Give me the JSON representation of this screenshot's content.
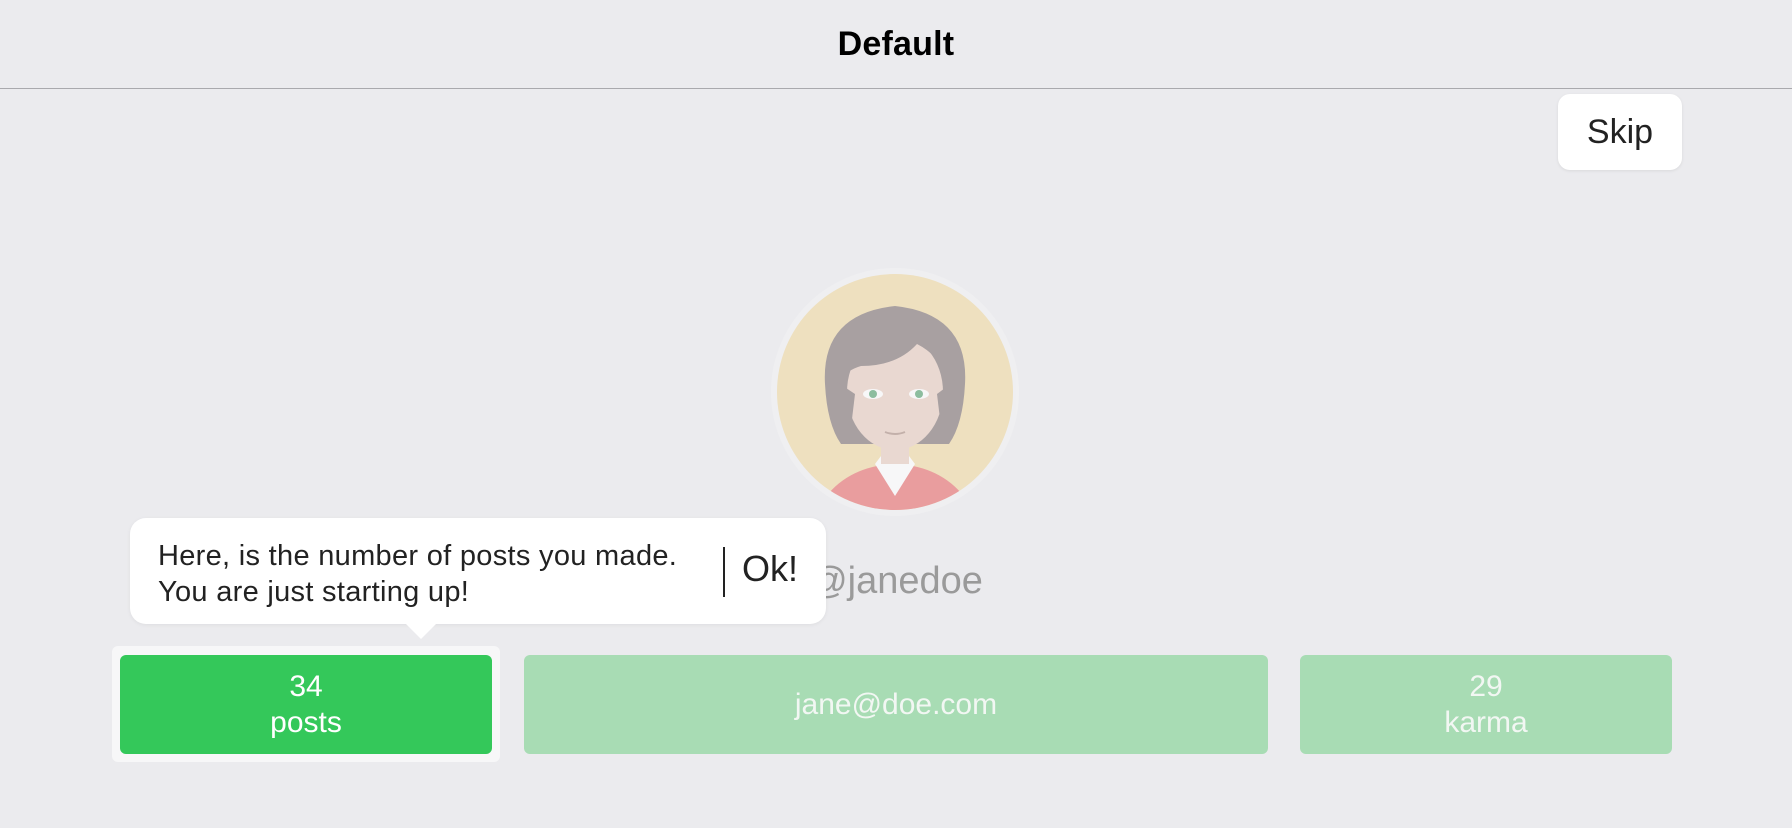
{
  "navbar": {
    "title": "Default"
  },
  "skip": {
    "label": "Skip"
  },
  "profile": {
    "username": "@janedoe",
    "avatar_icon": "woman-avatar-icon"
  },
  "stats": {
    "posts": {
      "value": "34",
      "label": "posts"
    },
    "email": {
      "value": "jane@doe.com"
    },
    "karma": {
      "value": "29",
      "label": "karma"
    }
  },
  "tooltip": {
    "line1": "Here, is the number of posts you made.",
    "line2": "You are just starting up!",
    "ok_label": "Ok!"
  },
  "colors": {
    "background": "#ebebee",
    "accent_green": "#34c85a",
    "faded_green": "#a8dcb4",
    "avatar_bg": "#f0d9a0"
  }
}
